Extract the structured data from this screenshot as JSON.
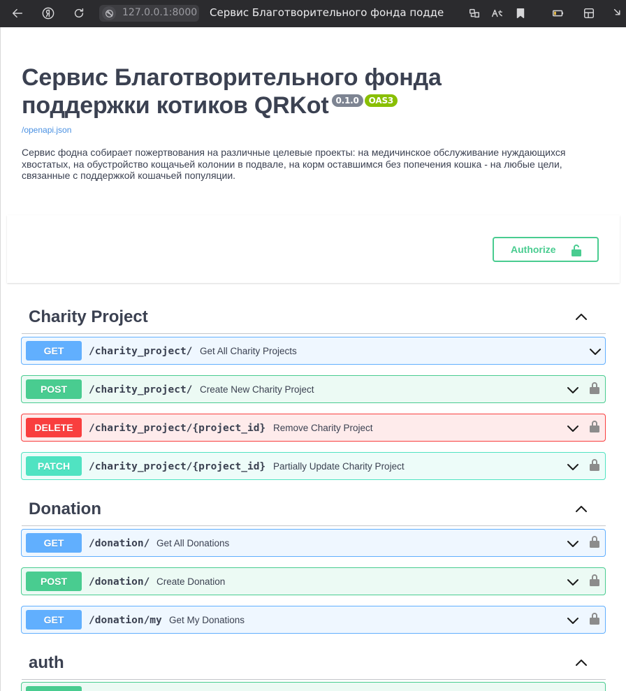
{
  "browser": {
    "url": "127.0.0.1:8000",
    "tab_title": "Сервис Благотворительного фонда поддер..."
  },
  "info": {
    "title_line1": "Сервис Благотворительного фонда",
    "title_line2": "поддержки котиков QRKot",
    "version": "0.1.0",
    "oas": "OAS3",
    "spec_link": "/openapi.json",
    "description": "Сервис фодна собирает пожертвования на различные целевые проекты: на медичинское обслуживание нуждающихся хвостатых, на обустройство кощачьей колонии в подвале, на корм оставшимся без попечения кошка - на любые цели, связанные с поддержкой кошачьей популяции."
  },
  "authorize": {
    "label": "Authorize"
  },
  "tags": [
    {
      "name": "Charity Project",
      "operations": [
        {
          "method": "GET",
          "path": "/charity_project/",
          "summary": "Get All Charity Projects",
          "locked": false
        },
        {
          "method": "POST",
          "path": "/charity_project/",
          "summary": "Create New Charity Project",
          "locked": true
        },
        {
          "method": "DELETE",
          "path": "/charity_project/{project_id}",
          "summary": "Remove Charity Project",
          "locked": true
        },
        {
          "method": "PATCH",
          "path": "/charity_project/{project_id}",
          "summary": "Partially Update Charity Project",
          "locked": true
        }
      ]
    },
    {
      "name": "Donation",
      "operations": [
        {
          "method": "GET",
          "path": "/donation/",
          "summary": "Get All Donations",
          "locked": true
        },
        {
          "method": "POST",
          "path": "/donation/",
          "summary": "Create Donation",
          "locked": true
        },
        {
          "method": "GET",
          "path": "/donation/my",
          "summary": "Get My Donations",
          "locked": true
        }
      ]
    },
    {
      "name": "auth",
      "operations": []
    }
  ],
  "colors": {
    "get": "#61affe",
    "post": "#49cc90",
    "delete": "#f93e3e",
    "patch": "#50e3c2"
  }
}
